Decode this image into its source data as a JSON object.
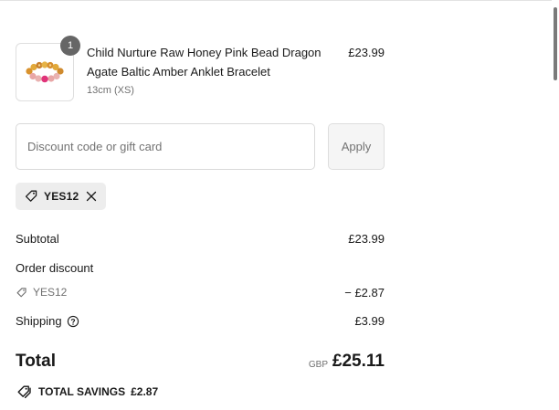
{
  "product": {
    "title": "Child Nurture Raw Honey Pink Bead Dragon Agate Baltic Amber Anklet Bracelet",
    "variant": "13cm (XS)",
    "price": "£23.99",
    "quantity": "1",
    "image_icon": "amber-bead-bracelet-image"
  },
  "discount": {
    "placeholder": "Discount code or gift card",
    "value": "",
    "apply_label": "Apply",
    "applied_code": "YES12"
  },
  "summary": {
    "subtotal_label": "Subtotal",
    "subtotal_value": "£23.99",
    "order_discount_label": "Order discount",
    "discount_code": "YES12",
    "discount_value": "− £2.87",
    "shipping_label": "Shipping",
    "shipping_value": "£3.99",
    "total_label": "Total",
    "currency": "GBP",
    "total_value": "£25.11",
    "savings_label": "TOTAL SAVINGS",
    "savings_value": "£2.87"
  },
  "colors": {
    "badge": "#666666",
    "chip_bg": "#ededed",
    "muted_text": "#707070",
    "border": "#d9d9d9"
  }
}
